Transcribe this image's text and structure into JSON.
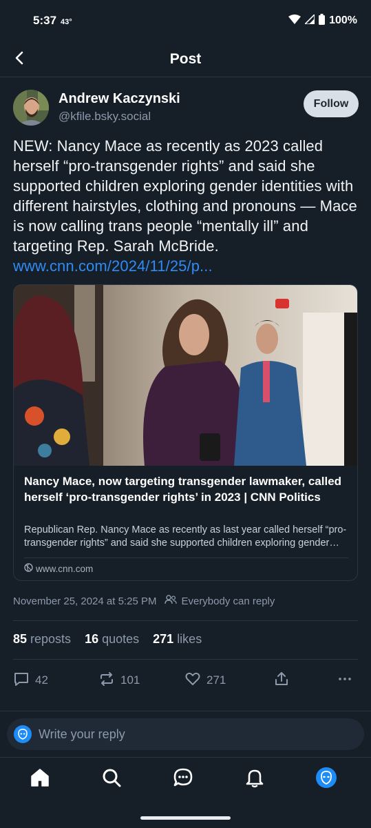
{
  "status_bar": {
    "time": "5:37",
    "temperature": "43°",
    "battery": "100%"
  },
  "header": {
    "title": "Post",
    "back_icon": "chevron-left-icon"
  },
  "author": {
    "name": "Andrew Kaczynski",
    "handle": "@kfile.bsky.social",
    "follow_label": "Follow"
  },
  "post": {
    "text": "NEW: Nancy Mace as recently as 2023 called herself “pro-transgender rights” and said she supported children exploring gender identities with different hairstyles, clothing and pronouns — Mace is now calling trans people “mentally ill” and targeting Rep. Sarah McBride. ",
    "link_text": "www.cnn.com/2024/11/25/p..."
  },
  "link_card": {
    "title": "Nancy Mace, now targeting transgender lawmaker, called herself ‘pro-transgender rights’ in 2023 | CNN Politics",
    "description": "Republican Rep. Nancy Mace as recently as last year called herself “pro-transgender rights” and said she supported children exploring gender identities",
    "domain": "www.cnn.com"
  },
  "meta": {
    "timestamp": "November 25, 2024 at 5:25 PM",
    "reply_permission": "Everybody can reply"
  },
  "stats": {
    "reposts_count": "85",
    "reposts_label": "reposts",
    "quotes_count": "16",
    "quotes_label": "quotes",
    "likes_count": "271",
    "likes_label": "likes"
  },
  "actions": {
    "replies": "42",
    "reposts": "101",
    "likes": "271"
  },
  "reply_bar": {
    "placeholder": "Write your reply"
  },
  "colors": {
    "background": "#161e27",
    "accent": "#2f8cf6",
    "muted": "#8c9aab",
    "divider": "#2b3643"
  }
}
